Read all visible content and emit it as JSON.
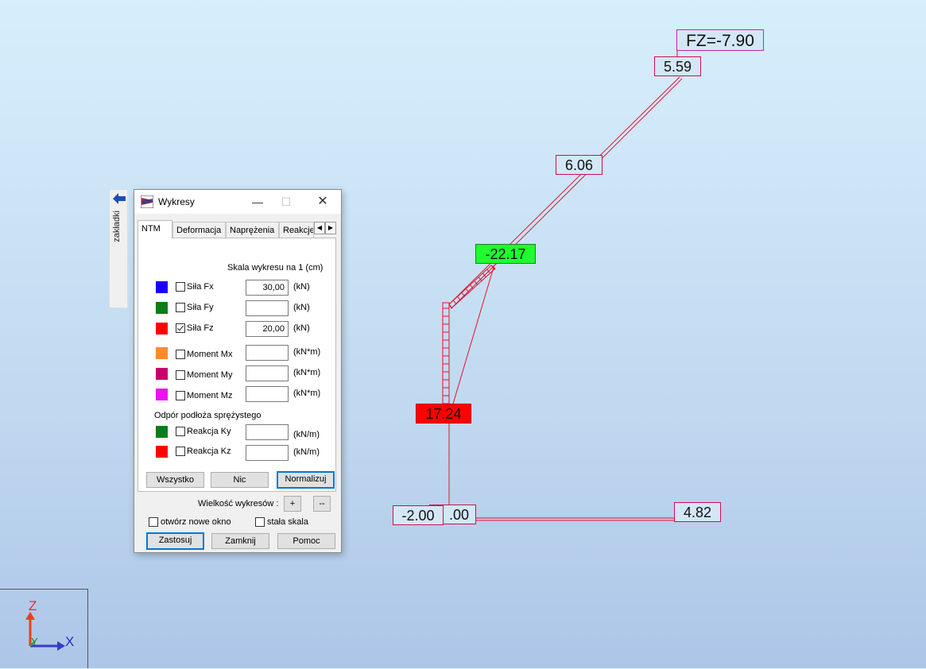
{
  "labels": {
    "fz_top": "FZ=-7.90",
    "v_5_59": "5.59",
    "v_6_06": "6.06",
    "v_neg22_17": "-22.17",
    "v_17_24": "17.24",
    "v_neg2_00": "-2.00",
    "v_00": ".00",
    "v_4_82": "4.82"
  },
  "colors": {
    "label_bg": "#d4e7f7",
    "label_border": "#d0104f",
    "green_label": "#1eff2e",
    "red_label": "#ff0000",
    "diagram_line": "#e8102e"
  },
  "sidetab": {
    "label": "zakładki",
    "icon": "arrow-left-icon"
  },
  "dialog": {
    "title": "Wykresy",
    "tabs": [
      "NTM",
      "Deformacja",
      "Naprężenia",
      "Reakcje"
    ],
    "scale_caption": "Skala wykresu na 1  (cm)",
    "rows": [
      {
        "name": "Siła Fx",
        "color": "#1a00ff",
        "checked": false,
        "value": "30,00",
        "unit": "(kN)"
      },
      {
        "name": "Siła Fy",
        "color": "#0a7d1a",
        "checked": false,
        "value": "",
        "unit": "(kN)"
      },
      {
        "name": "Siła Fz",
        "color": "#ff0000",
        "checked": true,
        "value": "20,00",
        "unit": "(kN)"
      },
      {
        "name": "Moment Mx",
        "color": "#ff8a2a",
        "checked": false,
        "value": "",
        "unit": "(kN*m)"
      },
      {
        "name": "Moment My",
        "color": "#c8006e",
        "checked": false,
        "value": "",
        "unit": "(kN*m)"
      },
      {
        "name": "Moment Mz",
        "color": "#ee11ee",
        "checked": false,
        "value": "",
        "unit": "(kN*m)"
      }
    ],
    "section_label": "Odpór podłoża sprężystego",
    "reactions": [
      {
        "name": "Reakcja Ky",
        "color": "#0a7d1a",
        "checked": false,
        "value": "",
        "unit": "(kN/m)"
      },
      {
        "name": "Reakcja Kz",
        "color": "#ff0000",
        "checked": false,
        "value": "",
        "unit": "(kN/m)"
      }
    ],
    "btn_all": "Wszystko",
    "btn_none": "Nic",
    "btn_normalize": "Normalizuj",
    "size_label": "Wielkość wykresów :",
    "size_plus": "+",
    "size_minus": "--",
    "open_new_window": "otwórz nowe okno",
    "fixed_scale": "stała  skala",
    "btn_apply": "Zastosuj",
    "btn_close": "Zamknij",
    "btn_help": "Pomoc"
  },
  "axes": {
    "z": "Z",
    "y": "Y",
    "x": "X"
  }
}
